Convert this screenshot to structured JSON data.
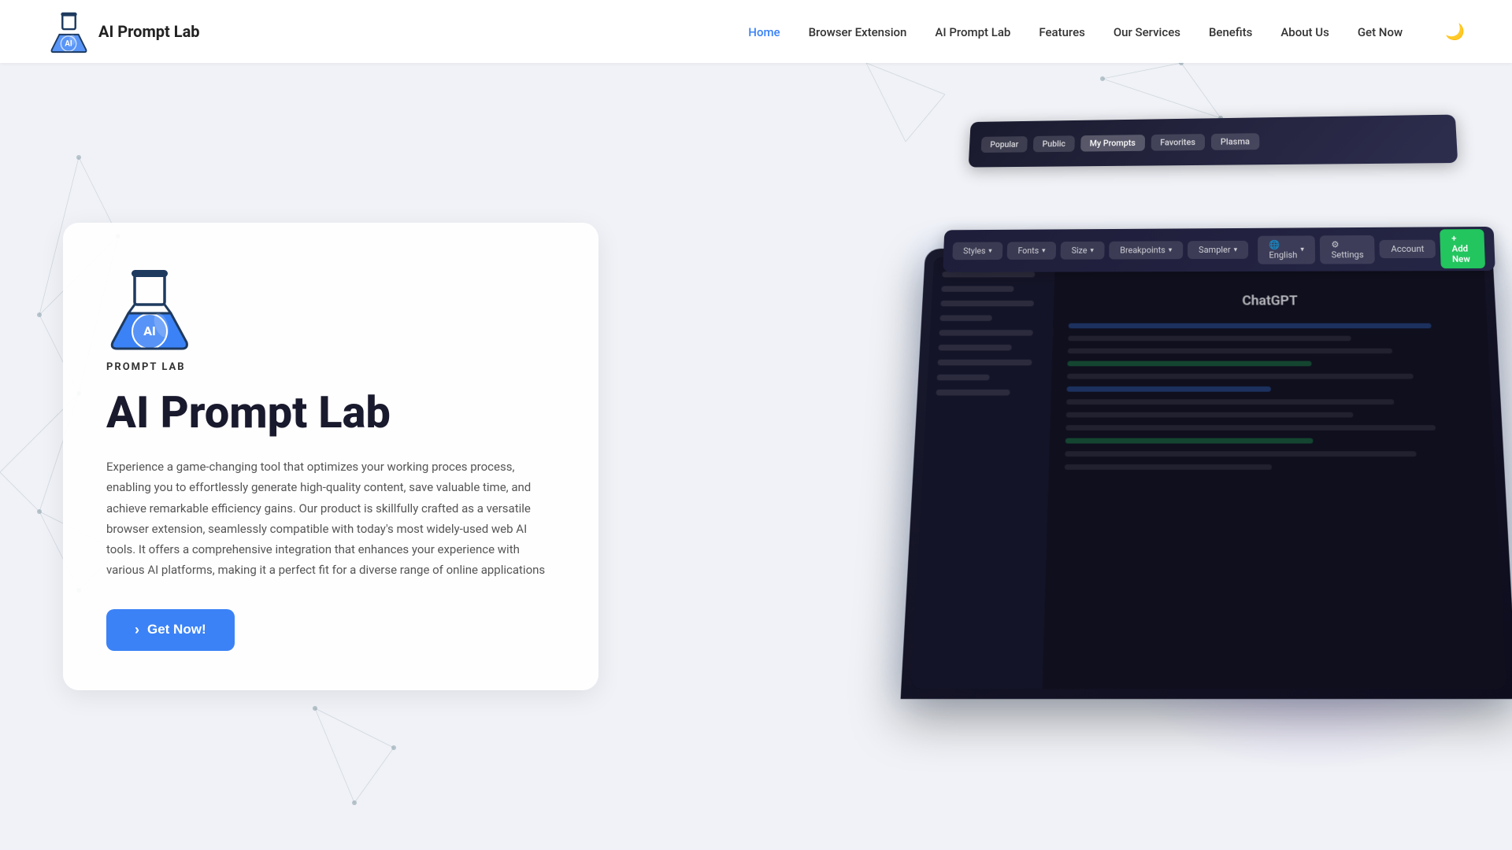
{
  "brand": {
    "name": "AI Prompt Lab",
    "logo_alt": "AI Prompt Lab Logo"
  },
  "nav": {
    "links": [
      {
        "id": "home",
        "label": "Home",
        "active": true
      },
      {
        "id": "browser-extension",
        "label": "Browser Extension",
        "active": false
      },
      {
        "id": "ai-prompt-lab",
        "label": "AI Prompt Lab",
        "active": false
      },
      {
        "id": "features",
        "label": "Features",
        "active": false
      },
      {
        "id": "our-services",
        "label": "Our Services",
        "active": false
      },
      {
        "id": "benefits",
        "label": "Benefits",
        "active": false
      },
      {
        "id": "about-us",
        "label": "About Us",
        "active": false
      },
      {
        "id": "get-now",
        "label": "Get Now",
        "active": false
      }
    ],
    "dark_mode_icon": "🌙"
  },
  "hero": {
    "card_logo_text": "PROMPT LAB",
    "title": "AI Prompt Lab",
    "description": "Experience a game-changing tool that optimizes your working proces process, enabling you to effortlessly generate high-quality content, save valuable time, and achieve remarkable efficiency gains. Our product is skillfully crafted as a versatile browser extension, seamlessly compatible with today's most widely-used web AI tools. It offers a comprehensive integration that enhances your experience with various AI platforms, making it a perfect fit for a diverse range of online applications",
    "cta_label": "Get Now!",
    "cta_chevron": "›"
  },
  "toolbar": {
    "tabs": [
      "Popular",
      "Public",
      "My Prompts",
      "Favorites",
      "Plasma"
    ],
    "active_tab": "My Prompts"
  },
  "toolbar2": {
    "chips": [
      "Styles ▾",
      "Fonts ▾",
      "Size ▾",
      "Breakpoints ▾",
      "Sampler ▾"
    ],
    "right_chips": [
      "English ▾",
      "Settings",
      "Account"
    ],
    "add_btn": "+ Add New"
  }
}
